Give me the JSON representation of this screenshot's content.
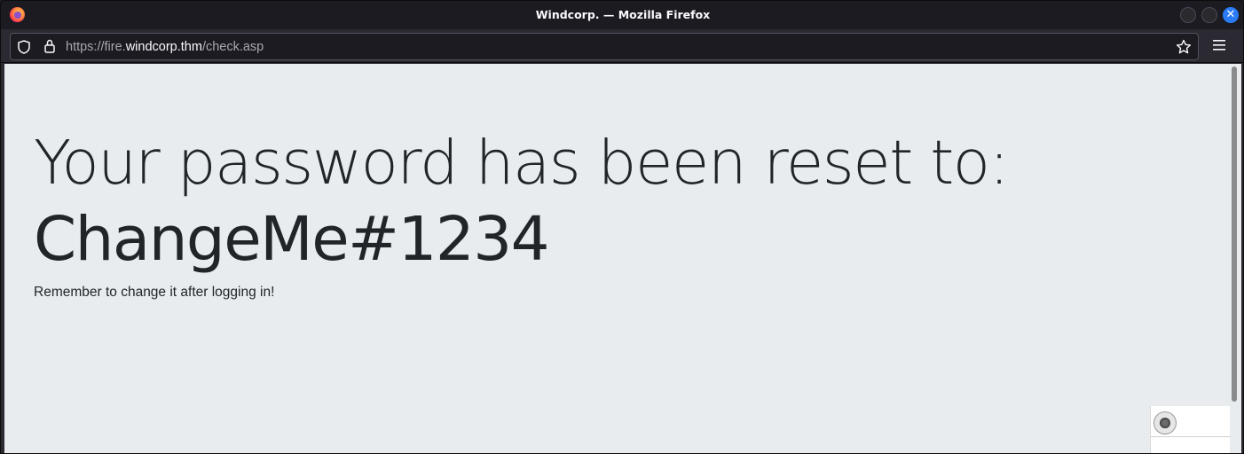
{
  "window": {
    "title": "Windcorp. — Mozilla Firefox"
  },
  "urlbar": {
    "scheme_and_sub": "https://fire.",
    "host": "windcorp.thm",
    "path": "/check.asp"
  },
  "page": {
    "headline": "Your password has been reset to:",
    "password": "ChangeMe#1234",
    "note": "Remember to change it after logging in!"
  },
  "icons": {
    "browser_logo": "firefox-logo-icon",
    "shield": "shield-icon",
    "lock": "lock-icon",
    "bookmark": "star-icon",
    "menu": "hamburger-menu-icon",
    "close": "close-icon",
    "widget": "record-icon"
  },
  "colors": {
    "page_background": "#e9ecef",
    "text": "#212529",
    "chrome_dark": "#1c1b22",
    "close_button": "#2a7cf5"
  }
}
